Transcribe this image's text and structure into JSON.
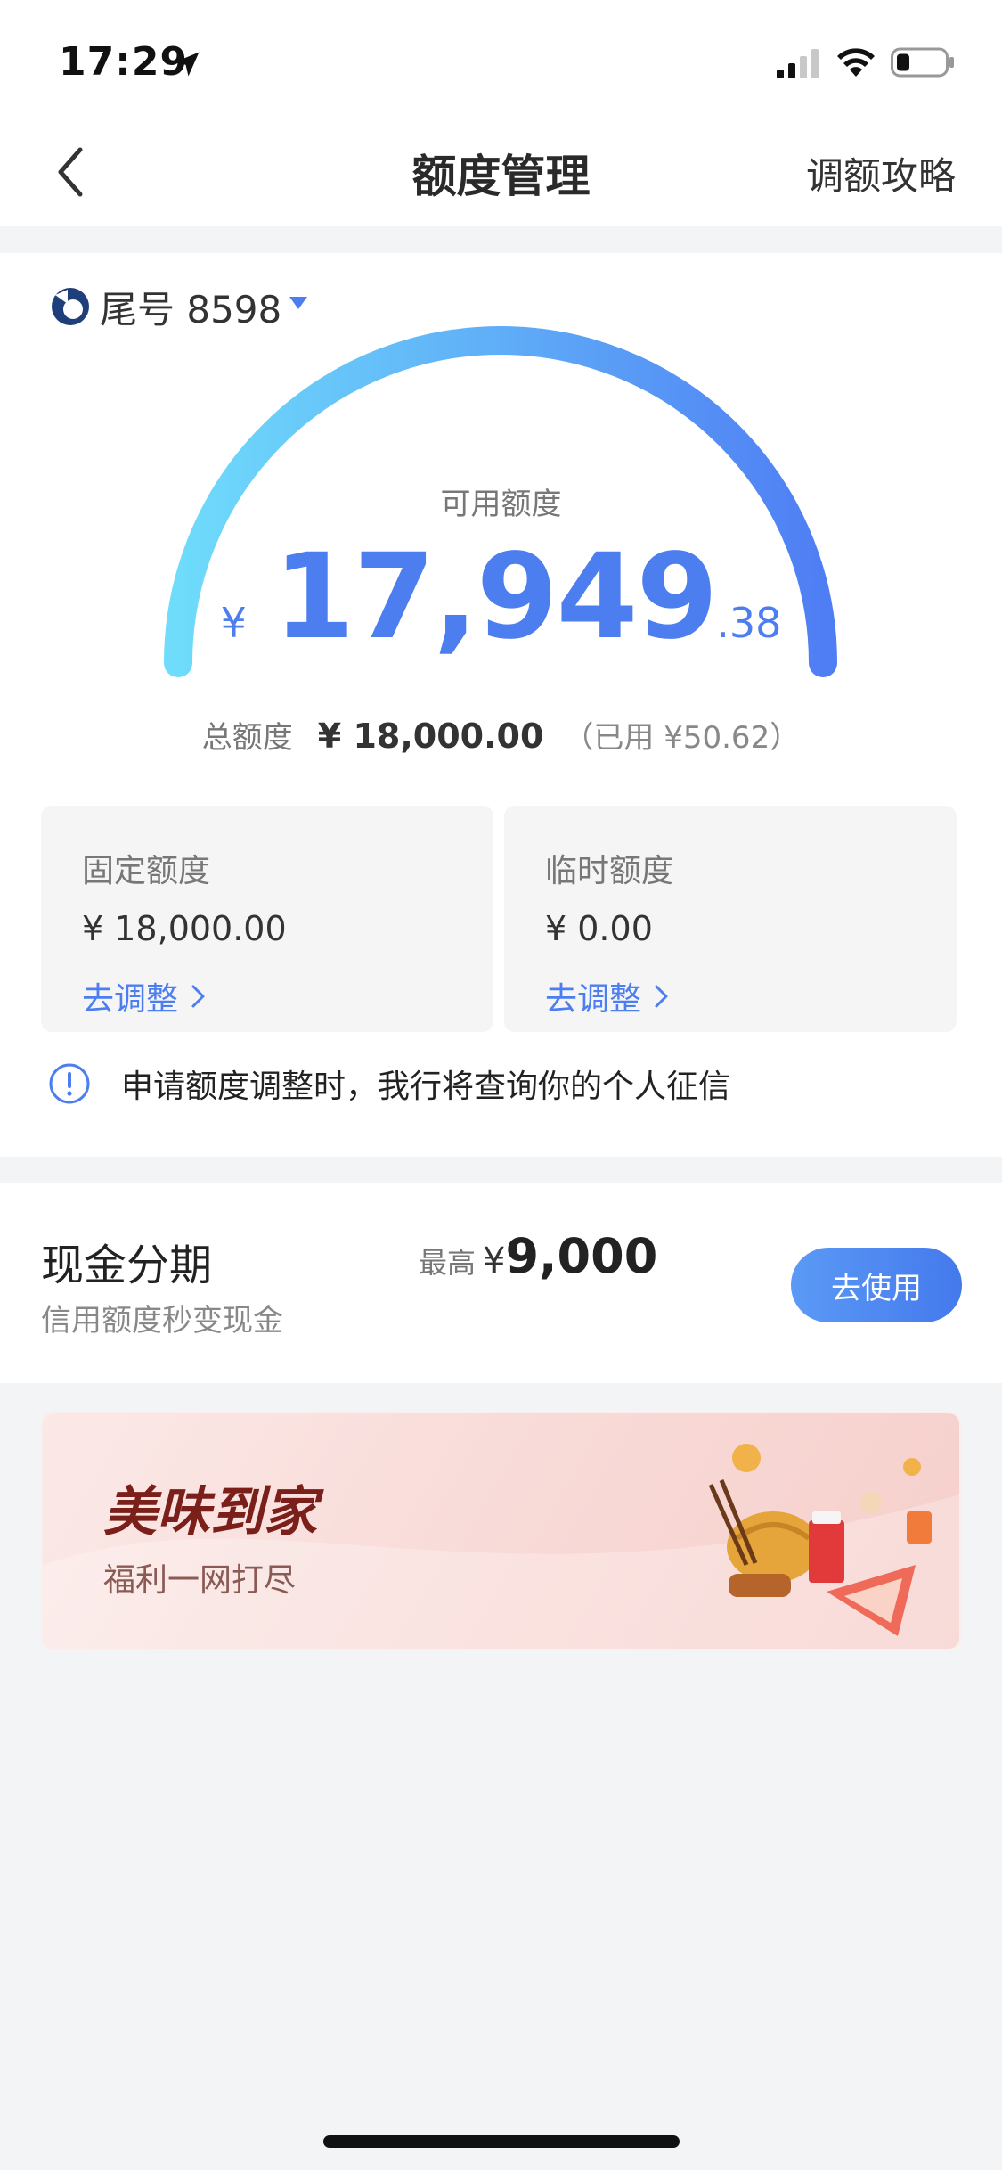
{
  "status_bar": {
    "time": "17:29"
  },
  "nav": {
    "title": "额度管理",
    "right_link": "调额攻略"
  },
  "card": {
    "tail_label": "尾号 8598"
  },
  "credit": {
    "available_label": "可用额度",
    "currency": "¥",
    "available_int": "17,949",
    "available_dec": ".38",
    "available_fraction_of_total": 0.9972,
    "total_label": "总额度",
    "total_value": "¥ 18,000.00",
    "used_value": "（已用 ¥50.62）",
    "gauge_colors": [
      "#6fdcfb",
      "#4f7ef4"
    ]
  },
  "quota": {
    "fixed": {
      "label": "固定额度",
      "value": "¥ 18,000.00",
      "link": "去调整"
    },
    "temporary": {
      "label": "临时额度",
      "value": "¥ 0.00",
      "link": "去调整"
    }
  },
  "notice": {
    "text": "申请额度调整时，我行将查询你的个人征信"
  },
  "cash": {
    "title": "现金分期",
    "subtitle": "信用额度秒变现金",
    "max_label": "最高",
    "max_currency": "¥",
    "max_value": "9,000",
    "button": "去使用"
  },
  "banner": {
    "title": "美味到家",
    "subtitle": "福利一网打尽"
  },
  "accent_color": "#4d7ef0"
}
